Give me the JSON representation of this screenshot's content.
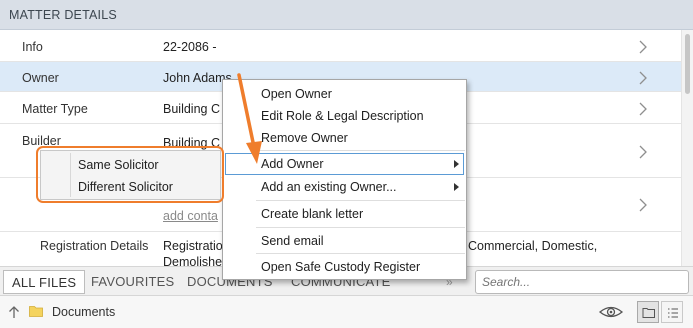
{
  "header": {
    "title": "MATTER DETAILS"
  },
  "rows": [
    {
      "label": "Info",
      "value": "22-2086 -"
    },
    {
      "label": "Owner",
      "value": "John Adams"
    },
    {
      "label": "Matter Type",
      "value": "Building C"
    },
    {
      "label": "Builder",
      "value": "Building C"
    },
    {
      "label": "",
      "value": "",
      "link": "add conta"
    },
    {
      "label": "Registration Details",
      "value": "Registratio",
      "value_line2": "Demolishe",
      "value_right": "Commercial, Domestic,"
    }
  ],
  "context_menu": {
    "items": [
      {
        "label": "Open Owner"
      },
      {
        "label": "Edit Role & Legal Description"
      },
      {
        "label": "Remove Owner"
      },
      {
        "label": "Add Owner",
        "has_submenu": true
      },
      {
        "label": "Add an existing Owner...",
        "has_submenu": true
      },
      {
        "label": "Create blank letter"
      },
      {
        "label": "Send email"
      },
      {
        "label": "Open Safe Custody Register"
      }
    ]
  },
  "submenu": {
    "items": [
      {
        "label": "Same Solicitor"
      },
      {
        "label": "Different Solicitor"
      }
    ]
  },
  "tabs": {
    "items": [
      "ALL FILES",
      "FAVOURITES",
      "DOCUMENTS",
      "COMMUNICATE"
    ],
    "active": "ALL FILES",
    "more": "»"
  },
  "search": {
    "placeholder": "Search..."
  },
  "breadcrumb": {
    "folder": "Documents"
  },
  "colors": {
    "header_bg": "#d9dfe7",
    "selected_row": "#dceaf8",
    "callout": "#ef7d2c",
    "menu_highlight_border": "#5b9bd5",
    "folder_icon": "#f4d35e"
  },
  "icons": {
    "row_chevron": "chevron-right-icon",
    "submenu_arrow": "submenu-arrow-icon",
    "up": "up-arrow-icon",
    "folder": "folder-icon",
    "eye": "eye-icon",
    "view_folder": "folder-view-icon",
    "view_list": "list-view-icon"
  }
}
